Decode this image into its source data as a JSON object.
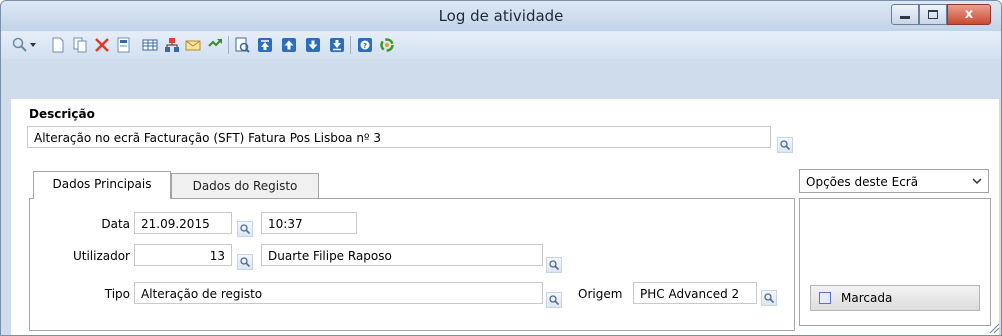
{
  "window": {
    "title": "Log de atividade",
    "minimize_icon": "minimize-icon",
    "maximize_icon": "maximize-icon",
    "close_label": "x"
  },
  "toolbar": {
    "tools": [
      "search",
      "new",
      "copy",
      "delete",
      "edit",
      "grid",
      "hierarchy",
      "message",
      "refresh",
      "preview",
      "first",
      "previous",
      "next",
      "last",
      "help",
      "options"
    ]
  },
  "descricao": {
    "label": "Descrição",
    "value": "Alteração no ecrã Facturação (SFT) Fatura Pos Lisboa nº 3"
  },
  "tabs": [
    {
      "label": "Dados Principais",
      "active": true
    },
    {
      "label": "Dados do Registo",
      "active": false
    }
  ],
  "main": {
    "data_label": "Data",
    "data_value": "21.09.2015",
    "hora_value": "10:37",
    "utilizador_label": "Utilizador",
    "utilizador_num": "13",
    "utilizador_nome": "Duarte Filipe Raposo",
    "tipo_label": "Tipo",
    "tipo_value": "Alteração de registo",
    "origem_label": "Origem",
    "origem_value": "PHC Advanced 2"
  },
  "options": {
    "select_label": "Opções deste Ecrã",
    "marcada_label": "Marcada"
  },
  "colors": {
    "window_bg": "#cfdcec",
    "accent": "#2a6ebd",
    "close": "#c94a32"
  }
}
